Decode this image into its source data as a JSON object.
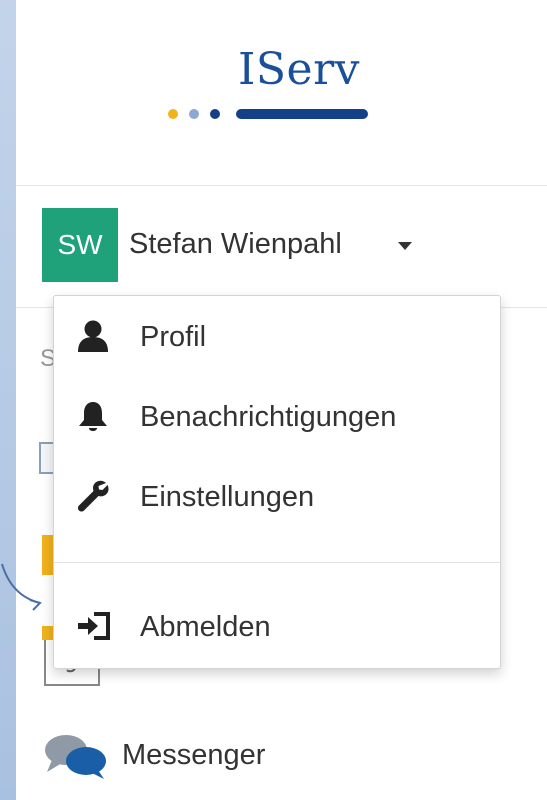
{
  "logo": {
    "text": "IServ",
    "colors": {
      "dark_blue": "#14408a",
      "light_blue": "#8ea8d2",
      "yellow": "#f2b21c"
    }
  },
  "user": {
    "initials": "SW",
    "name": "Stefan Wienpahl",
    "avatar_color": "#1fa279"
  },
  "user_menu": {
    "items": [
      {
        "label": "Profil",
        "icon": "user-icon"
      },
      {
        "label": "Benachrichtigungen",
        "icon": "bell-icon"
      },
      {
        "label": "Einstellungen",
        "icon": "wrench-icon"
      }
    ],
    "logout": {
      "label": "Abmelden",
      "icon": "sign-out-icon"
    }
  },
  "sidebar": {
    "partial_letter": "S",
    "messenger": {
      "label": "Messenger",
      "icon": "chat-bubbles-icon"
    }
  },
  "annotation": {
    "arrow_color": "#4a6fa5"
  }
}
